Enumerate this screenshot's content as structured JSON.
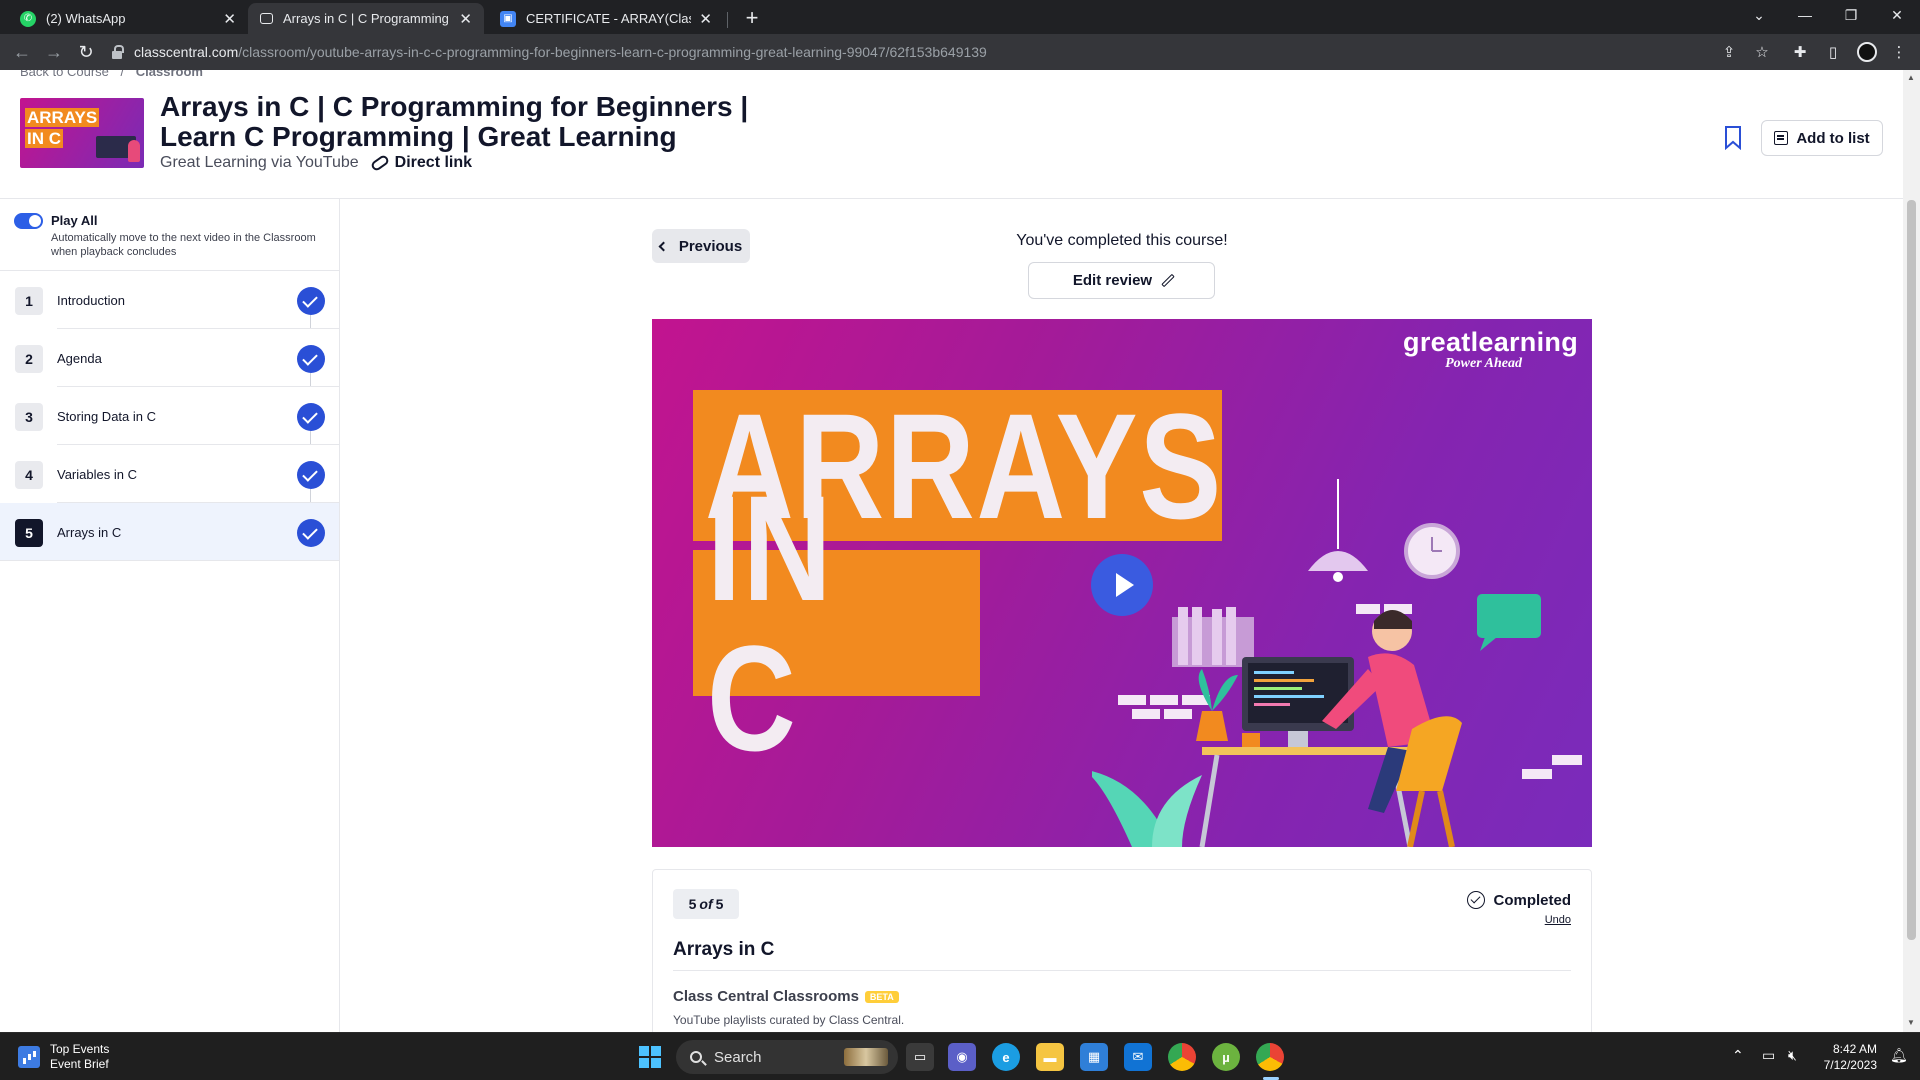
{
  "browser": {
    "tabs": [
      {
        "title": "(2) WhatsApp",
        "icon": "whatsapp-icon",
        "active": false
      },
      {
        "title": "Arrays in C | C Programming for B",
        "icon": "classcentral-icon",
        "active": true
      },
      {
        "title": "CERTIFICATE - ARRAY(Class Centr",
        "icon": "google-slides-icon",
        "active": false
      }
    ],
    "url_host": "classcentral.com",
    "url_path": "/classroom/youtube-arrays-in-c-c-programming-for-beginners-learn-c-programming-great-learning-99047/62f153b649139"
  },
  "header": {
    "breadcrumb": [
      "Back to Course",
      "/",
      "Classroom"
    ],
    "thumb_line1": "ARRAYS",
    "thumb_line2": "IN C",
    "title": "Arrays in C | C Programming for Beginners | Learn C Programming | Great Learning",
    "provider": "Great Learning via YouTube",
    "direct_link": "Direct link",
    "add_to_list": "Add to list"
  },
  "sidebar": {
    "play_all_title": "Play All",
    "play_all_desc": "Automatically move to the next video in the Classroom when playback concludes",
    "play_all_on": true,
    "lessons": [
      {
        "num": "1",
        "name": "Introduction",
        "completed": true
      },
      {
        "num": "2",
        "name": "Agenda",
        "completed": true
      },
      {
        "num": "3",
        "name": "Storing Data in C",
        "completed": true
      },
      {
        "num": "4",
        "name": "Variables in C",
        "completed": true
      },
      {
        "num": "5",
        "name": "Arrays in C",
        "completed": true,
        "current": true
      }
    ]
  },
  "main": {
    "previous": "Previous",
    "completed_msg": "You've completed this course!",
    "edit_review": "Edit review",
    "video": {
      "brand": "greatlearning",
      "tagline": "Power Ahead",
      "line1": "ARRAYS",
      "line2": "IN C"
    },
    "card": {
      "count_current": "5",
      "count_of": "of",
      "count_total": "5",
      "status": "Completed",
      "undo": "Undo",
      "title": "Arrays in C",
      "cc_title": "Class Central Classrooms",
      "beta": "BETA",
      "cc_desc": "YouTube playlists curated by Class Central."
    }
  },
  "taskbar": {
    "widget_title": "Top Events",
    "widget_sub": "Event Brief",
    "search": "Search",
    "time": "8:42 AM",
    "date": "7/12/2023"
  },
  "colors": {
    "accent": "#2a4fd6",
    "video_orange": "#f28a1f",
    "video_purple": "#8524b0"
  }
}
